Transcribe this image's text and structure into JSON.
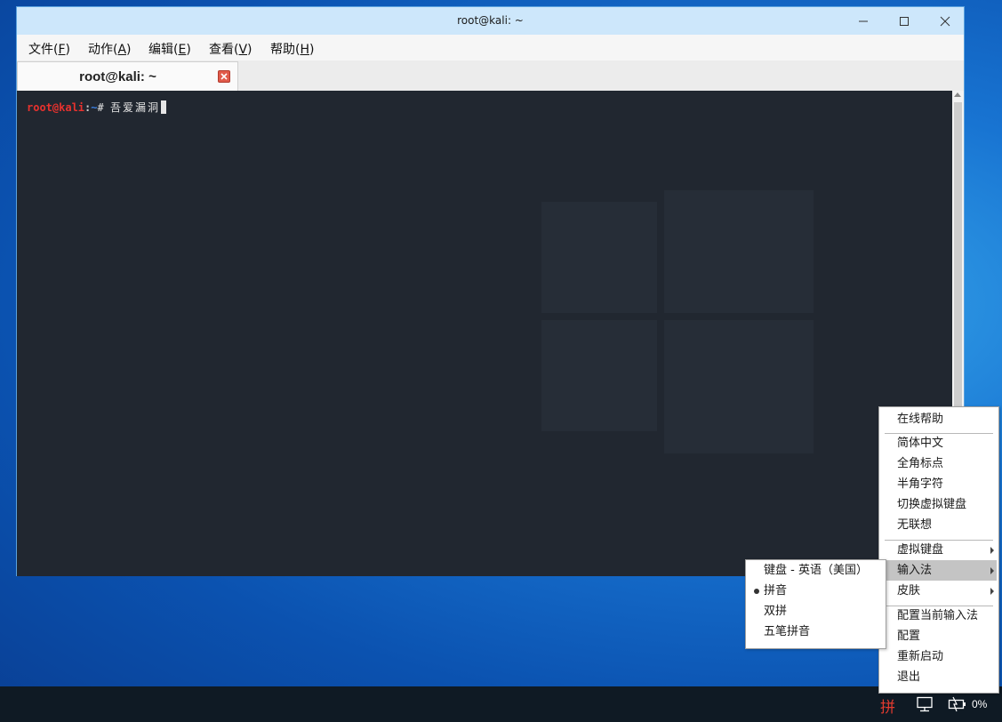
{
  "window": {
    "title": "root@kali: ~"
  },
  "menubar": {
    "items": [
      {
        "text": "文件(",
        "key": "F",
        "end": ")"
      },
      {
        "text": "动作(",
        "key": "A",
        "end": ")"
      },
      {
        "text": "编辑(",
        "key": "E",
        "end": ")"
      },
      {
        "text": "查看(",
        "key": "V",
        "end": ")"
      },
      {
        "text": "帮助(",
        "key": "H",
        "end": ")"
      }
    ]
  },
  "tab": {
    "label": "root@kali: ~"
  },
  "terminal": {
    "user_host": "root@kali",
    "separator": ":",
    "path": "~",
    "hash": "# ",
    "command": "吾爱漏洞"
  },
  "ime_menu": {
    "items": [
      {
        "label": "在线帮助"
      },
      {
        "label": "简体中文"
      },
      {
        "label": "全角标点"
      },
      {
        "label": "半角字符"
      },
      {
        "label": "切换虚拟键盘"
      },
      {
        "label": "无联想"
      },
      {
        "label": "虚拟键盘",
        "submenu": true
      },
      {
        "label": "输入法",
        "submenu": true,
        "highlighted": true
      },
      {
        "label": "皮肤",
        "submenu": true
      },
      {
        "label": "配置当前输入法"
      },
      {
        "label": "配置"
      },
      {
        "label": "重新启动"
      },
      {
        "label": "退出"
      }
    ]
  },
  "input_method_submenu": {
    "items": [
      {
        "label": "键盘 - 英语（美国）",
        "selected": false
      },
      {
        "label": "拼音",
        "selected": true
      },
      {
        "label": "双拼",
        "selected": false
      },
      {
        "label": "五笔拼音",
        "selected": false
      }
    ]
  },
  "taskbar": {
    "ime_indicator": "拼",
    "battery_percent": "0%",
    "icons": [
      "network-icon",
      "battery-icon"
    ]
  },
  "colors": {
    "prompt_user": "#e8322e",
    "prompt_path": "#3b7fe0",
    "terminal_bg": "#212730",
    "titlebar": "#cde7fb",
    "menu_highlight": "#c4c4c4"
  }
}
